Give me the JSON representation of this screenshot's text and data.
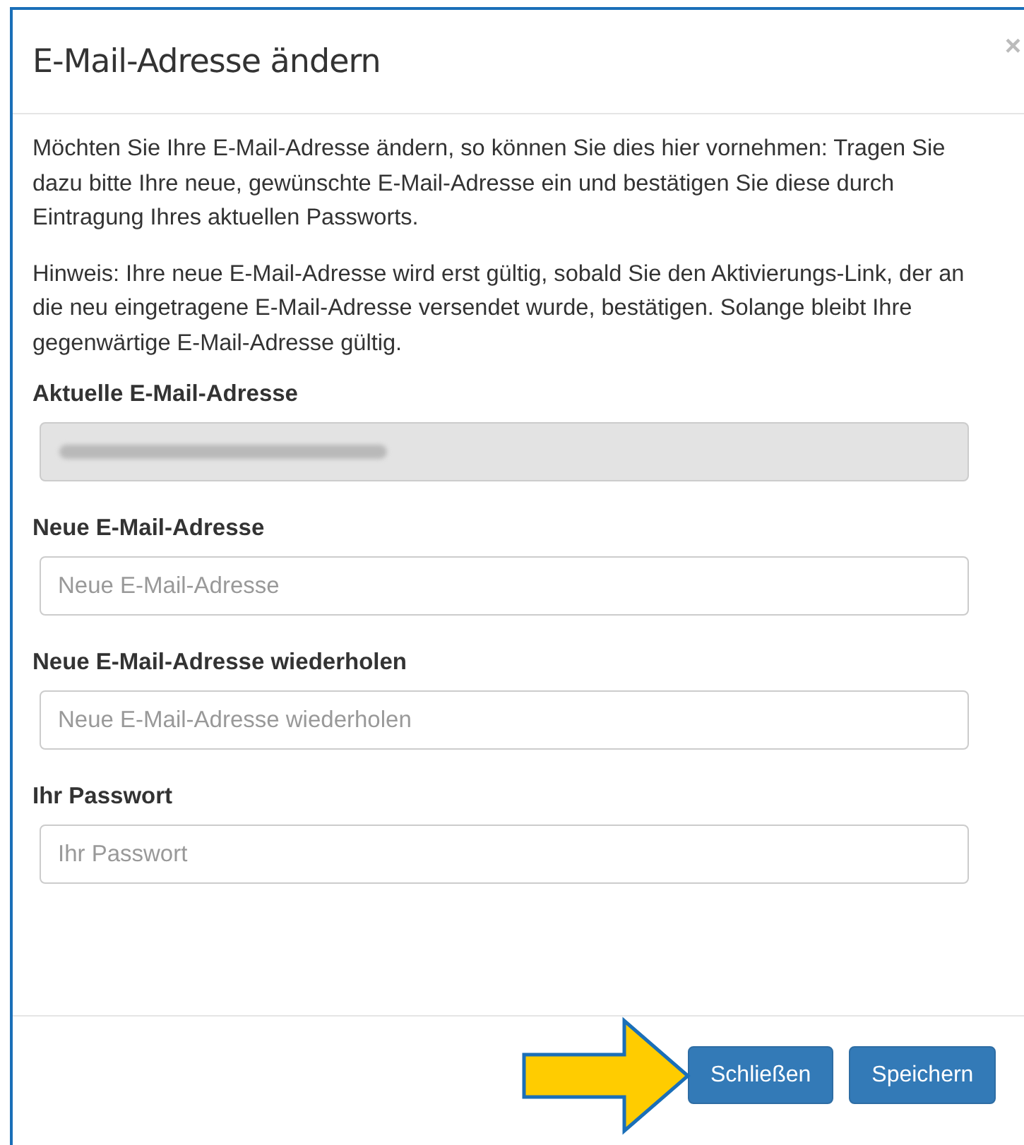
{
  "dialog": {
    "title": "E-Mail-Adresse ändern",
    "close": "×",
    "paragraphs": [
      "Möchten Sie Ihre E-Mail-Adresse ändern, so können Sie dies hier vornehmen: Tragen Sie dazu bitte Ihre neue, gewünschte E-Mail-Adresse ein und bestätigen Sie diese durch Eintragung Ihres aktuellen Passworts.",
      "Hinweis: Ihre neue E-Mail-Adresse wird erst gültig, sobald Sie den Aktivierungs-Link, der an die neu eingetragene E-Mail-Adresse versendet wurde, bestätigen. Solange bleibt Ihre gegenwärtige E-Mail-Adresse gültig."
    ],
    "fields": [
      {
        "label": "Aktuelle E-Mail-Adresse",
        "disabled": true,
        "redacted": true
      },
      {
        "label": "Neue E-Mail-Adresse",
        "placeholder": "Neue E-Mail-Adresse",
        "disabled": false
      },
      {
        "label": "Neue E-Mail-Adresse wiederholen",
        "placeholder": "Neue E-Mail-Adresse wiederholen",
        "disabled": false
      },
      {
        "label": "Ihr Passwort",
        "placeholder": "Ihr Passwort",
        "disabled": false
      }
    ],
    "buttons": [
      "Schließen",
      "Speichern"
    ]
  },
  "annotation": {
    "kind": "arrow"
  }
}
